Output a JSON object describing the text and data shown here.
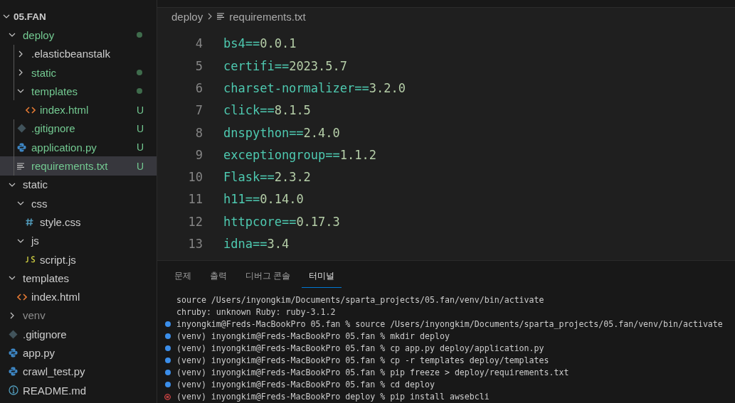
{
  "explorer": {
    "root": {
      "label": "05.FAN",
      "expanded": true
    },
    "items": [
      {
        "label": "deploy",
        "kind": "folder",
        "expanded": true,
        "changed": true,
        "ignored": false,
        "selected": false,
        "children": [
          {
            "label": ".elasticbeanstalk",
            "kind": "folder",
            "expanded": false,
            "changed": false,
            "ignored": false,
            "selected": false
          },
          {
            "label": "static",
            "kind": "folder",
            "expanded": false,
            "changed": true,
            "ignored": false,
            "selected": false
          },
          {
            "label": "templates",
            "kind": "folder",
            "expanded": true,
            "changed": true,
            "ignored": false,
            "selected": false,
            "children": [
              {
                "label": "index.html",
                "kind": "html",
                "changed": true,
                "ignored": false,
                "badge": "U",
                "selected": false
              }
            ]
          },
          {
            "label": ".gitignore",
            "kind": "git",
            "changed": true,
            "ignored": false,
            "badge": "U",
            "selected": false
          },
          {
            "label": "application.py",
            "kind": "python",
            "changed": true,
            "ignored": false,
            "badge": "U",
            "selected": false
          },
          {
            "label": "requirements.txt",
            "kind": "text",
            "changed": true,
            "ignored": false,
            "badge": "U",
            "selected": true
          }
        ]
      },
      {
        "label": "static",
        "kind": "folder",
        "expanded": true,
        "changed": false,
        "ignored": false,
        "selected": false,
        "children": [
          {
            "label": "css",
            "kind": "folder",
            "expanded": true,
            "changed": false,
            "ignored": false,
            "selected": false,
            "children": [
              {
                "label": "style.css",
                "kind": "css",
                "changed": false,
                "ignored": false,
                "selected": false
              }
            ]
          },
          {
            "label": "js",
            "kind": "folder",
            "expanded": true,
            "changed": false,
            "ignored": false,
            "selected": false,
            "children": [
              {
                "label": "script.js",
                "kind": "js",
                "changed": false,
                "ignored": false,
                "selected": false
              }
            ]
          }
        ]
      },
      {
        "label": "templates",
        "kind": "folder",
        "expanded": true,
        "changed": false,
        "ignored": false,
        "selected": false,
        "children": [
          {
            "label": "index.html",
            "kind": "html",
            "changed": false,
            "ignored": false,
            "selected": false
          }
        ]
      },
      {
        "label": "venv",
        "kind": "folder",
        "expanded": false,
        "changed": false,
        "ignored": true,
        "selected": false
      },
      {
        "label": ".gitignore",
        "kind": "git",
        "changed": false,
        "ignored": false,
        "selected": false
      },
      {
        "label": "app.py",
        "kind": "python",
        "changed": false,
        "ignored": false,
        "selected": false
      },
      {
        "label": "crawl_test.py",
        "kind": "python",
        "changed": false,
        "ignored": false,
        "selected": false
      },
      {
        "label": "README.md",
        "kind": "info",
        "changed": false,
        "ignored": false,
        "selected": false
      }
    ]
  },
  "breadcrumb": {
    "folder": "deploy",
    "file": "requirements.txt"
  },
  "editor": {
    "lines": [
      {
        "number": "4",
        "name": "bs4",
        "op": "==",
        "version": "0.0.1"
      },
      {
        "number": "5",
        "name": "certifi",
        "op": "==",
        "version": "2023.5.7"
      },
      {
        "number": "6",
        "name": "charset-normalizer",
        "op": "==",
        "version": "3.2.0"
      },
      {
        "number": "7",
        "name": "click",
        "op": "==",
        "version": "8.1.5"
      },
      {
        "number": "8",
        "name": "dnspython",
        "op": "==",
        "version": "2.4.0"
      },
      {
        "number": "9",
        "name": "exceptiongroup",
        "op": "==",
        "version": "1.1.2"
      },
      {
        "number": "10",
        "name": "Flask",
        "op": "==",
        "version": "2.3.2"
      },
      {
        "number": "11",
        "name": "h11",
        "op": "==",
        "version": "0.14.0"
      },
      {
        "number": "12",
        "name": "httpcore",
        "op": "==",
        "version": "0.17.3"
      },
      {
        "number": "13",
        "name": "idna",
        "op": "==",
        "version": "3.4"
      }
    ]
  },
  "panel": {
    "tabs": [
      {
        "label": "문제",
        "selected": false
      },
      {
        "label": "출력",
        "selected": false
      },
      {
        "label": "디버그 콘솔",
        "selected": false
      },
      {
        "label": "터미널",
        "selected": true
      }
    ],
    "terminal": [
      {
        "kind": "plain",
        "text": "source /Users/inyongkim/Documents/sparta_projects/05.fan/venv/bin/activate"
      },
      {
        "kind": "plain",
        "text": "chruby: unknown Ruby: ruby-3.1.2"
      },
      {
        "kind": "success",
        "text": "inyongkim@Freds-MacBookPro 05.fan % source /Users/inyongkim/Documents/sparta_projects/05.fan/venv/bin/activate"
      },
      {
        "kind": "success",
        "text": "(venv) inyongkim@Freds-MacBookPro 05.fan % mkdir deploy"
      },
      {
        "kind": "success",
        "text": "(venv) inyongkim@Freds-MacBookPro 05.fan % cp app.py deploy/application.py"
      },
      {
        "kind": "success",
        "text": "(venv) inyongkim@Freds-MacBookPro 05.fan % cp -r templates deploy/templates"
      },
      {
        "kind": "success",
        "text": "(venv) inyongkim@Freds-MacBookPro 05.fan % pip freeze > deploy/requirements.txt"
      },
      {
        "kind": "success",
        "text": "(venv) inyongkim@Freds-MacBookPro 05.fan % cd deploy"
      },
      {
        "kind": "error",
        "text": "(venv) inyongkim@Freds-MacBookPro deploy % pip install awsebcli"
      }
    ]
  }
}
